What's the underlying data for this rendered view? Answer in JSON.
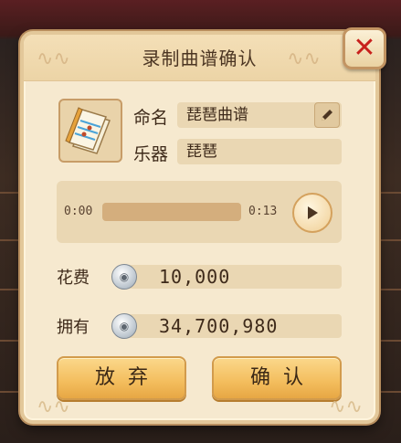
{
  "dialog": {
    "title": "录制曲谱确认",
    "close_icon": "close-x-icon"
  },
  "score": {
    "icon": "music-score-book-icon",
    "name_label": "命名",
    "name_value": "琵琶曲谱",
    "edit_icon": "pencil-icon",
    "instrument_label": "乐器",
    "instrument_value": "琵琶"
  },
  "player": {
    "current_time": "0:00",
    "total_time": "0:13",
    "progress": 0.0,
    "play_icon": "play-icon"
  },
  "cost": {
    "label": "花费",
    "amount": "10,000",
    "coin_icon": "silver-coin-icon"
  },
  "owned": {
    "label": "拥有",
    "amount": "34,700,980",
    "coin_icon": "silver-coin-icon"
  },
  "buttons": {
    "cancel": "放弃",
    "confirm": "确认"
  }
}
